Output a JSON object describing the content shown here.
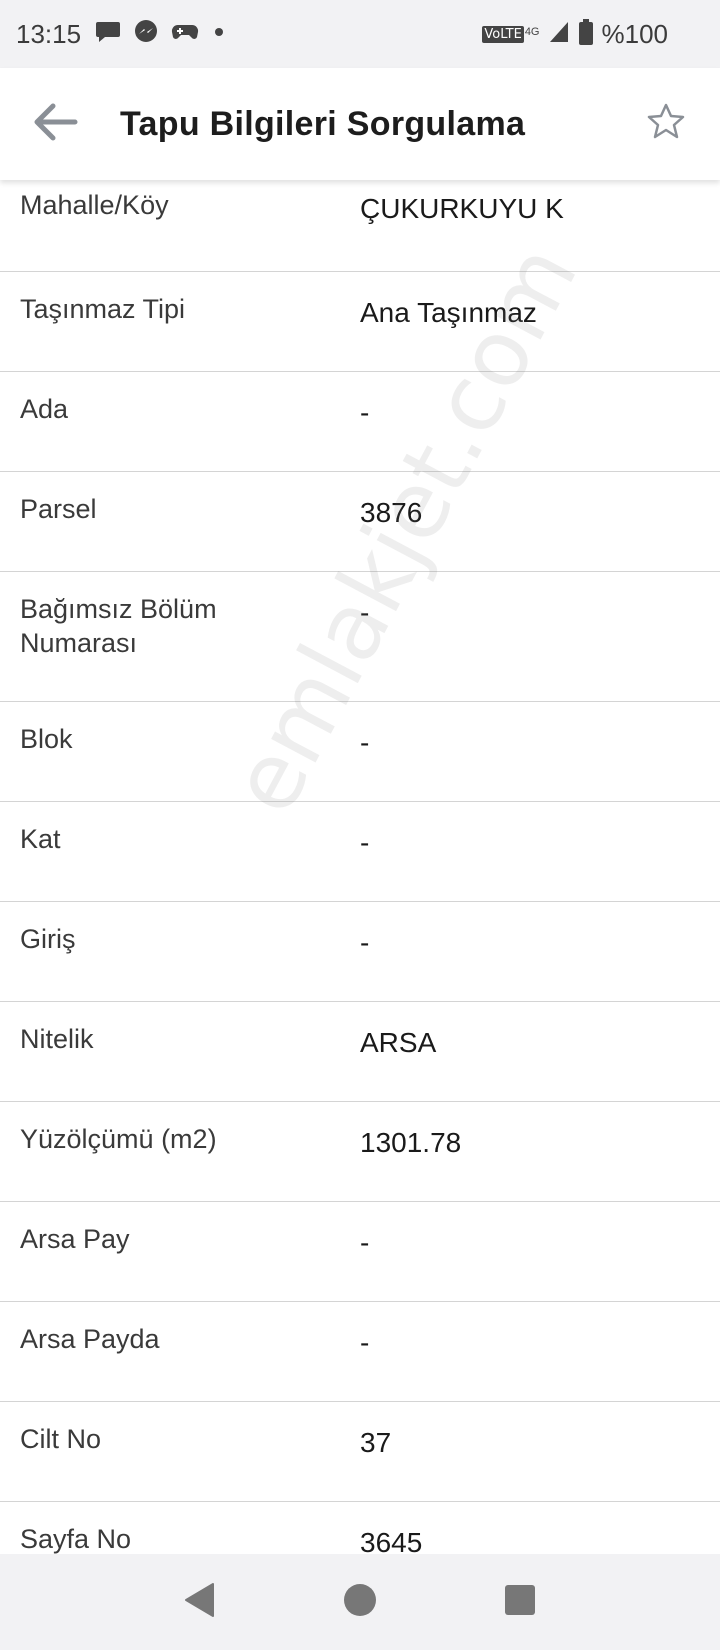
{
  "status_bar": {
    "time": "13:15",
    "left_icons": [
      "chat-bubble-icon",
      "messenger-icon",
      "gamepad-icon",
      "dot-icon"
    ],
    "network_label": "VoLTE",
    "network_type": "4G",
    "battery_text": "%100"
  },
  "app_bar": {
    "title": "Tapu Bilgileri Sorgulama",
    "back_icon": "arrow-left-icon",
    "favorite_icon": "star-outline-icon"
  },
  "rows": [
    {
      "label": "Mahalle/Köy",
      "value": "ÇUKURKUYU K"
    },
    {
      "label": "Taşınmaz Tipi",
      "value": "Ana Taşınmaz"
    },
    {
      "label": "Ada",
      "value": "-"
    },
    {
      "label": "Parsel",
      "value": "3876"
    },
    {
      "label": "Bağımsız Bölüm Numarası",
      "value": "-"
    },
    {
      "label": "Blok",
      "value": "-"
    },
    {
      "label": "Kat",
      "value": "-"
    },
    {
      "label": "Giriş",
      "value": "-"
    },
    {
      "label": "Nitelik",
      "value": "ARSA"
    },
    {
      "label": "Yüzölçümü (m2)",
      "value": "1301.78"
    },
    {
      "label": "Arsa Pay",
      "value": "-"
    },
    {
      "label": "Arsa Payda",
      "value": "-"
    },
    {
      "label": "Cilt No",
      "value": "37"
    },
    {
      "label": "Sayfa No",
      "value": "3645"
    }
  ],
  "watermark": "emlakjet.com",
  "nav_bar": {
    "back": "triangle-back-icon",
    "home": "circle-home-icon",
    "recents": "square-recents-icon"
  },
  "colors": {
    "status_bg": "#f2f2f4",
    "divider": "#d4d4d4",
    "text_primary": "#1a1a1a",
    "icon_gray": "#8a8f96"
  }
}
